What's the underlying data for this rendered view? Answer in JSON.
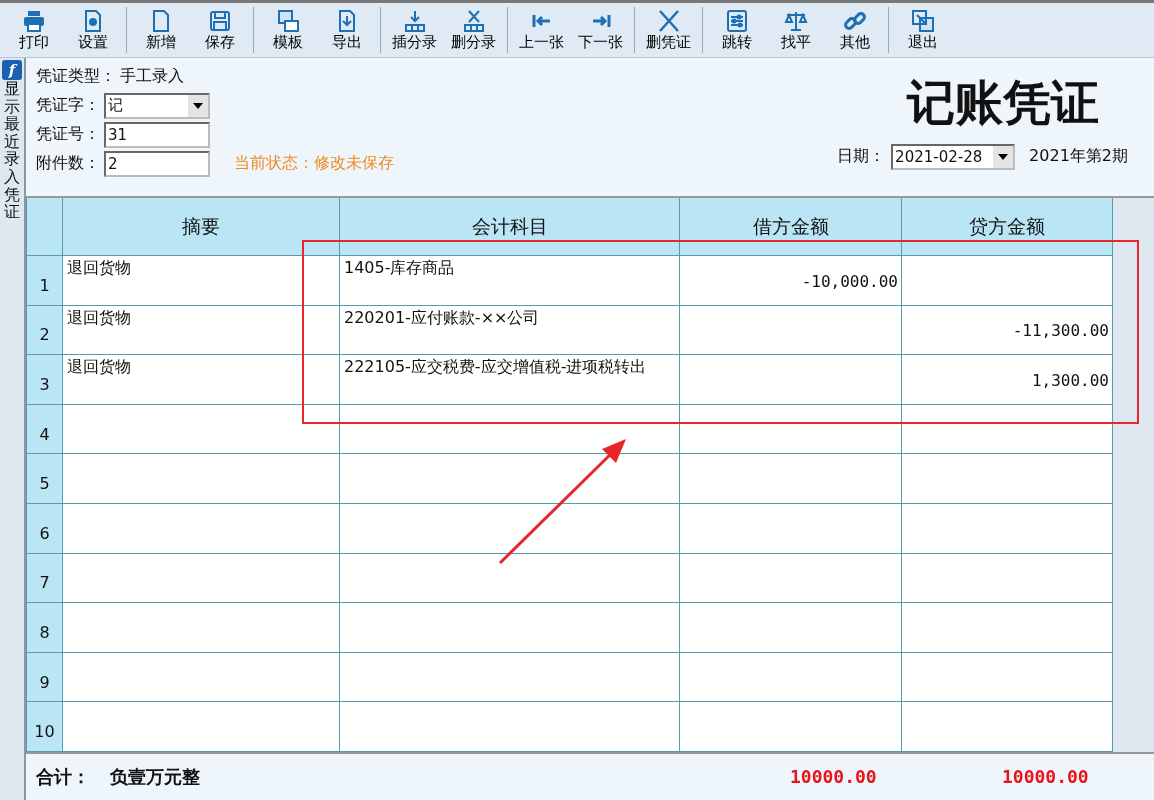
{
  "toolbar": [
    [
      {
        "label": "打印"
      },
      {
        "label": "设置"
      }
    ],
    [
      {
        "label": "新增"
      },
      {
        "label": "保存"
      }
    ],
    [
      {
        "label": "模板"
      },
      {
        "label": "导出"
      }
    ],
    [
      {
        "label": "插分录"
      },
      {
        "label": "删分录"
      }
    ],
    [
      {
        "label": "上一张"
      },
      {
        "label": "下一张"
      }
    ],
    [
      {
        "label": "删凭证"
      }
    ],
    [
      {
        "label": "跳转"
      },
      {
        "label": "找平"
      },
      {
        "label": "其他"
      }
    ],
    [
      {
        "label": "退出"
      }
    ]
  ],
  "side_panel": {
    "logo": "f",
    "label": "显示最近录入凭证"
  },
  "header": {
    "type_label": "凭证类型：",
    "type_value": "手工录入",
    "fields": [
      {
        "label": "凭证字：",
        "value": "记",
        "kind": "dropdown"
      },
      {
        "label": "凭证号：",
        "value": "31",
        "kind": "text"
      },
      {
        "label": "附件数：",
        "value": "2",
        "kind": "text"
      }
    ],
    "status": "当前状态：修改未保存",
    "title": "记账凭证",
    "date_label": "日期：",
    "date_value": "2021-02-28",
    "period": "2021年第2期"
  },
  "table": {
    "columns": [
      "摘要",
      "会计科目",
      "借方金额",
      "贷方金额"
    ],
    "rows": [
      {
        "number": "1",
        "summary": "退回货物",
        "account": "1405-库存商品",
        "debit": "-10,000.00"
      },
      {
        "number": "2",
        "summary": "退回货物",
        "account": "220201-应付账款-××公司",
        "credit": "-11,300.00"
      },
      {
        "number": "3",
        "summary": "退回货物",
        "account": "222105-应交税费-应交增值税-进项税转出",
        "credit": "1,300.00"
      },
      {
        "number": "4"
      },
      {
        "number": "5"
      },
      {
        "number": "6"
      },
      {
        "number": "7"
      },
      {
        "number": "8"
      },
      {
        "number": "9"
      },
      {
        "number": "10"
      }
    ]
  },
  "footer": {
    "label": "合计：",
    "amount_words": "负壹万元整",
    "debit_total": "10000.00",
    "credit_total": "10000.00"
  }
}
